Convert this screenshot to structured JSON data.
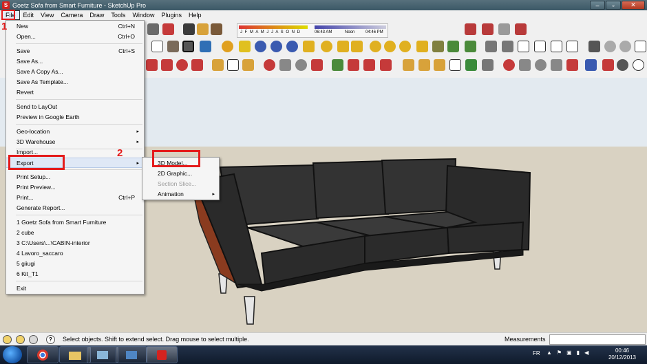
{
  "window": {
    "title": "Goetz Sofa from Smart Furniture - SketchUp Pro",
    "minimize_glyph": "–",
    "maximize_glyph": "▫",
    "close_glyph": "✕"
  },
  "menubar": [
    "File",
    "Edit",
    "View",
    "Camera",
    "Draw",
    "Tools",
    "Window",
    "Plugins",
    "Help"
  ],
  "shadow_settings": {
    "months": "J F M A M J J A S O N D",
    "time_start": "06:43 AM",
    "time_mid": "Noon",
    "time_end": "04:46 PM"
  },
  "file_menu": {
    "items": [
      {
        "label": "New",
        "shortcut": "Ctrl+N"
      },
      {
        "label": "Open...",
        "shortcut": "Ctrl+O"
      },
      {
        "label": "Save",
        "shortcut": "Ctrl+S"
      },
      {
        "label": "Save As...",
        "shortcut": ""
      },
      {
        "label": "Save A Copy As...",
        "shortcut": ""
      },
      {
        "label": "Save As Template...",
        "shortcut": ""
      },
      {
        "label": "Revert",
        "shortcut": ""
      },
      {
        "label": "Send to LayOut",
        "shortcut": ""
      },
      {
        "label": "Preview in Google Earth",
        "shortcut": ""
      },
      {
        "label": "Geo-location",
        "shortcut": ""
      },
      {
        "label": "3D Warehouse",
        "shortcut": ""
      },
      {
        "label": "Import...",
        "shortcut": ""
      },
      {
        "label": "Export",
        "shortcut": ""
      },
      {
        "label": "Print Setup...",
        "shortcut": ""
      },
      {
        "label": "Print Preview...",
        "shortcut": ""
      },
      {
        "label": "Print...",
        "shortcut": "Ctrl+P"
      },
      {
        "label": "Generate Report...",
        "shortcut": ""
      },
      {
        "label": "1 Goetz Sofa from Smart Furniture",
        "shortcut": ""
      },
      {
        "label": "2 cube",
        "shortcut": ""
      },
      {
        "label": "3 C:\\Users\\...\\CABIN-interior",
        "shortcut": ""
      },
      {
        "label": "4 Lavoro_saccaro",
        "shortcut": ""
      },
      {
        "label": "5 giiugi",
        "shortcut": ""
      },
      {
        "label": "6 Kit_T1",
        "shortcut": ""
      },
      {
        "label": "Exit",
        "shortcut": ""
      }
    ],
    "submenu_arrow": "▸"
  },
  "export_submenu": {
    "items": [
      {
        "label": "3D Model...",
        "enabled": true
      },
      {
        "label": "2D Graphic...",
        "enabled": true
      },
      {
        "label": "Section Slice...",
        "enabled": false
      },
      {
        "label": "Animation",
        "enabled": true
      }
    ]
  },
  "annotations": {
    "step1": "1",
    "step2": "2"
  },
  "statusbar": {
    "hint": "Select objects. Shift to extend select. Drag mouse to select multiple.",
    "measurements_label": "Measurements",
    "measurements_value": "",
    "help_glyph": "?"
  },
  "taskbar": {
    "language": "FR",
    "time": "00:46",
    "date": "20/12/2013"
  },
  "colors": {
    "accent_red": "#e41b1b",
    "sofa": "#2e2e2e",
    "wood": "#8a3b1f",
    "sky": "#e3eaf0",
    "ground": "#d9d2c2"
  }
}
